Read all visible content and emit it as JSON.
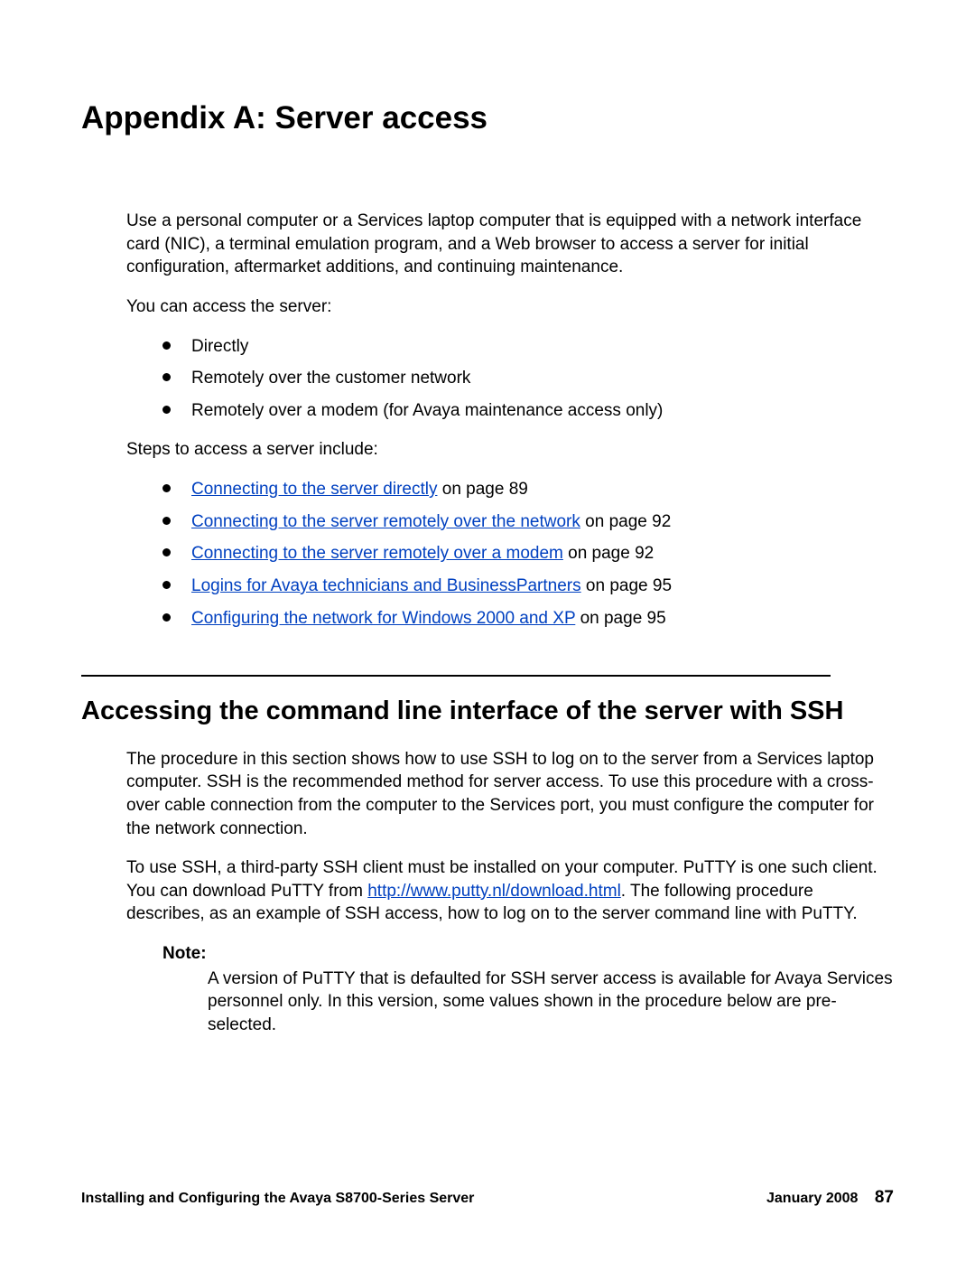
{
  "title": "Appendix A: Server access",
  "intro": {
    "p1": "Use a personal computer or a Services laptop computer that is equipped with a network interface card (NIC), a terminal emulation program, and a Web browser to access a server for initial configuration, aftermarket additions, and continuing maintenance.",
    "p2": "You can access the server:",
    "access_list": [
      "Directly",
      "Remotely over the customer network",
      "Remotely over a modem (for Avaya maintenance access only)"
    ],
    "p3": "Steps to access a server include:",
    "steps": [
      {
        "link": "Connecting to the server directly",
        "suffix": " on page 89"
      },
      {
        "link": "Connecting to the server remotely over the network",
        "suffix": " on page 92"
      },
      {
        "link": "Connecting to the server remotely over a modem",
        "suffix": " on page 92"
      },
      {
        "link": "Logins for Avaya technicians and BusinessPartners",
        "suffix": " on page 95"
      },
      {
        "link": "Configuring the network for Windows 2000 and XP",
        "suffix": " on page 95"
      }
    ]
  },
  "section": {
    "heading": "Accessing the command line interface of the server with SSH",
    "p1": "The procedure in this section shows how to use SSH to log on to the server from a Services laptop computer. SSH is the recommended method for server access. To use this procedure with a cross-over cable connection from the computer to the Services port, you must configure the computer for the network connection.",
    "p2_pre": "To use SSH, a third-party SSH client must be installed on your computer. PuTTY is one such client. You can download PuTTY from ",
    "p2_link": "http://www.putty.nl/download.html",
    "p2_post": ". The following procedure describes, as an example of SSH access, how to log on to the server command line with PuTTY.",
    "note_label": "Note:",
    "note_body": "A version of PuTTY that is defaulted for SSH server access is available for Avaya Services personnel only. In this version, some values shown in the procedure below are pre-selected."
  },
  "footer": {
    "left": "Installing and Configuring the Avaya S8700-Series Server",
    "date": "January 2008",
    "page": "87"
  }
}
